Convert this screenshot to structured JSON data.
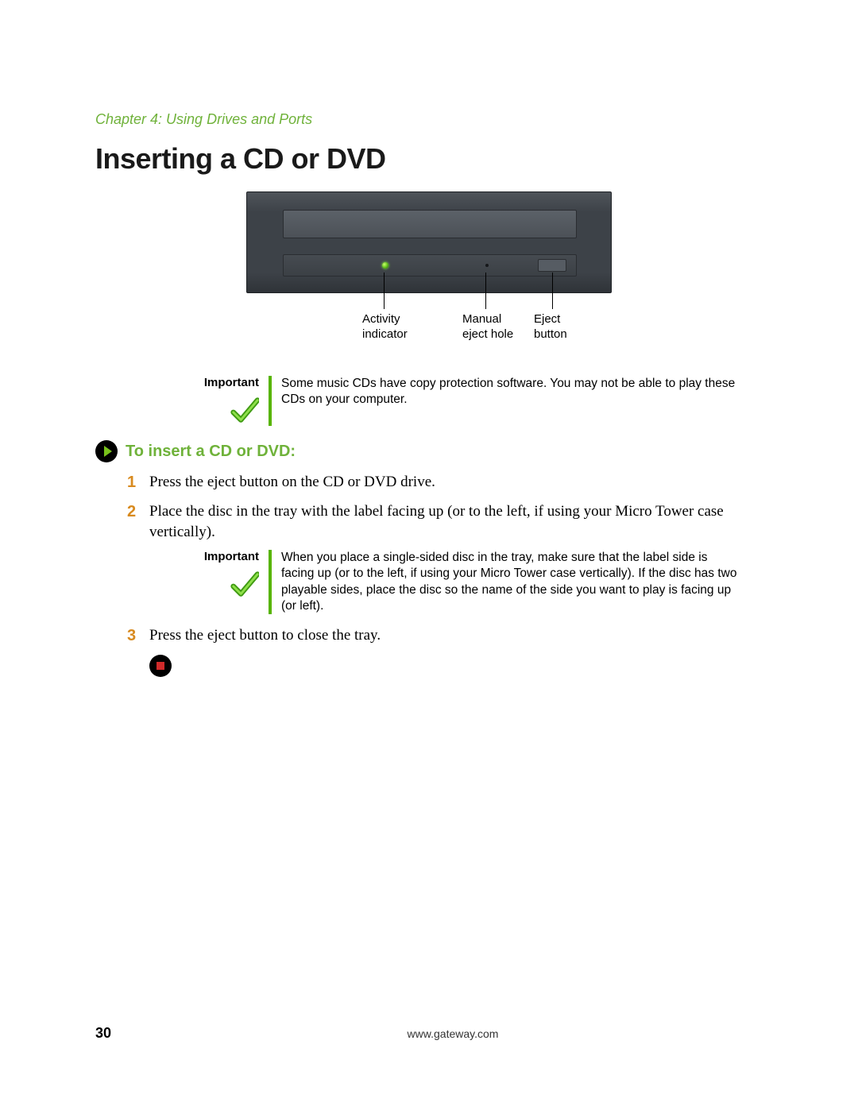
{
  "chapter": "Chapter 4: Using Drives and Ports",
  "title": "Inserting a CD or DVD",
  "callouts": {
    "activity": "Activity\nindicator",
    "manual": "Manual\neject hole",
    "eject": "Eject\nbutton"
  },
  "important_label": "Important",
  "important1": "Some music CDs have copy protection software. You may not be able to play these CDs on your computer.",
  "procedure_title": "To insert a CD or DVD:",
  "steps": {
    "s1_num": "1",
    "s1": "Press the eject button on the CD or DVD drive.",
    "s2_num": "2",
    "s2": "Place the disc in the tray with the label facing up (or to the left, if using your Micro Tower case vertically).",
    "s3_num": "3",
    "s3": "Press the eject button to close the tray."
  },
  "important2": "When you place a single-sided disc in the tray, make sure that the label side is facing up (or to the left, if using your Micro Tower case vertically). If the disc has two playable sides, place the disc so the name of the side you want to play is facing up (or left).",
  "footer": {
    "page": "30",
    "url": "www.gateway.com"
  }
}
